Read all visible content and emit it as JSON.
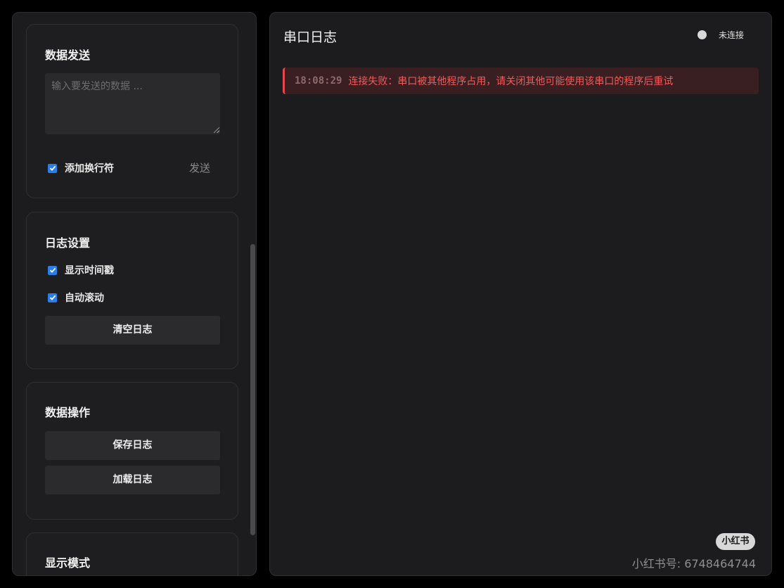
{
  "sidebar": {
    "data_send": {
      "title": "数据发送",
      "input_placeholder": "输入要发送的数据 ...",
      "input_value": "",
      "newline_label": "添加换行符",
      "newline_checked": true,
      "send_label": "发送"
    },
    "log_settings": {
      "title": "日志设置",
      "timestamp_label": "显示时间戳",
      "timestamp_checked": true,
      "autoscroll_label": "自动滚动",
      "autoscroll_checked": true,
      "clear_label": "清空日志"
    },
    "data_ops": {
      "title": "数据操作",
      "save_label": "保存日志",
      "load_label": "加载日志"
    },
    "display_mode": {
      "title": "显示模式"
    }
  },
  "main": {
    "title": "串口日志",
    "status_text": "未连接",
    "status_color": "#d8d8d8",
    "logs": [
      {
        "time": "18:08:29",
        "message": "连接失败：串口被其他程序占用，请关闭其他可能使用该串口的程序后重试",
        "level": "error"
      }
    ]
  },
  "watermark": {
    "badge": "小红书",
    "id_text": "小红书号: 6748464744"
  },
  "colors": {
    "accent": "#2b7de9",
    "error_text": "#f25a5a",
    "error_border": "#e5484d",
    "error_bg": "#3a1f22"
  }
}
